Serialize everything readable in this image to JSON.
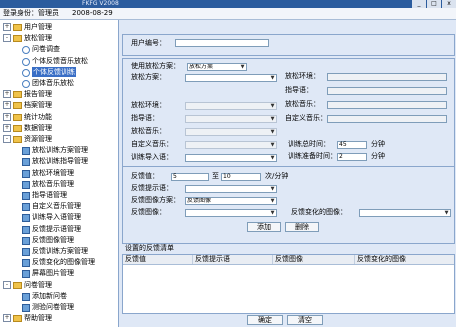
{
  "window": {
    "title": "FKFG V2008",
    "min_label": "_",
    "max_label": "□",
    "close_label": "x"
  },
  "userbar": {
    "role_label": "登录身份：管理员",
    "date": "2008-08-29"
  },
  "tree": {
    "items": [
      {
        "label": "用户管理",
        "toggle": "+",
        "kind": "folder"
      },
      {
        "label": "放松管理",
        "toggle": "-",
        "kind": "folder"
      },
      {
        "label": "问卷调查",
        "kind": "ring"
      },
      {
        "label": "个体反馈音乐放松",
        "kind": "ring"
      },
      {
        "label": "个体反馈训练",
        "kind": "ring",
        "selected": true
      },
      {
        "label": "团体音乐放松",
        "kind": "ring"
      },
      {
        "label": "报告管理",
        "toggle": "+",
        "kind": "folder"
      },
      {
        "label": "档案管理",
        "toggle": "+",
        "kind": "folder"
      },
      {
        "label": "统计功能",
        "toggle": "+",
        "kind": "folder"
      },
      {
        "label": "数据管理",
        "toggle": "+",
        "kind": "folder"
      },
      {
        "label": "资源管理",
        "toggle": "-",
        "kind": "folder"
      },
      {
        "label": "放松训练方案管理",
        "kind": "doc"
      },
      {
        "label": "放松训练指导管理",
        "kind": "doc"
      },
      {
        "label": "放松环境管理",
        "kind": "doc"
      },
      {
        "label": "放松音乐管理",
        "kind": "doc"
      },
      {
        "label": "指导语管理",
        "kind": "doc"
      },
      {
        "label": "自定义音乐管理",
        "kind": "doc"
      },
      {
        "label": "训练导入语管理",
        "kind": "doc"
      },
      {
        "label": "反馈提示语管理",
        "kind": "doc"
      },
      {
        "label": "反馈图像管理",
        "kind": "doc"
      },
      {
        "label": "反馈训练方案管理",
        "kind": "doc"
      },
      {
        "label": "反馈变化的图像管理",
        "kind": "doc"
      },
      {
        "label": "屏幕图片管理",
        "kind": "doc"
      },
      {
        "label": "问卷管理",
        "toggle": "-",
        "kind": "folder"
      },
      {
        "label": "添加新问卷",
        "kind": "doc"
      },
      {
        "label": "测验问卷管理",
        "kind": "doc"
      },
      {
        "label": "帮助管理",
        "toggle": "+",
        "kind": "folder"
      }
    ]
  },
  "form": {
    "user_no_label": "用户编号：",
    "user_no_value": "",
    "use_plan_label": "使用放松方案：",
    "use_plan_value": "放松方案",
    "plan_label": "放松方案：",
    "plan_value": "",
    "env_right_label": "放松环境：",
    "guide_right_label": "指导语：",
    "music_right_label": "放松音乐：",
    "custom_right_label": "自定义音乐：",
    "env_label": "放松环境：",
    "guide_label": "指导语：",
    "music_label": "放松音乐：",
    "custom_label": "自定义音乐：",
    "import_label": "训练导入语：",
    "total_time_label": "训练总时间：",
    "total_time_value": "45",
    "total_time_unit": "分钟",
    "prep_time_label": "训练准备时间：",
    "prep_time_value": "2",
    "prep_time_unit": "分钟",
    "fb_value_label": "反馈值：",
    "fb_from": "5",
    "fb_to_label": "至",
    "fb_to": "10",
    "fb_unit": "次/分钟",
    "fb_hint_label": "反馈提示语：",
    "fb_img_plan_label": "反馈图像方案：",
    "fb_img_plan_value": "反馈图像",
    "fb_img_label": "反馈图像：",
    "fb_change_label": "反馈变化的图像：",
    "add_label": "添加",
    "delete_label": "删除",
    "list_title": "设置的反馈清单",
    "columns": [
      "反馈值",
      "反馈提示语",
      "反馈图像",
      "反馈变化的图像"
    ],
    "ok_label": "确定",
    "clear_label": "清空"
  },
  "colors": {
    "titlebar": "#2b5c9e",
    "selected": "#3a6fc6",
    "panel": "#dfe8f6"
  }
}
